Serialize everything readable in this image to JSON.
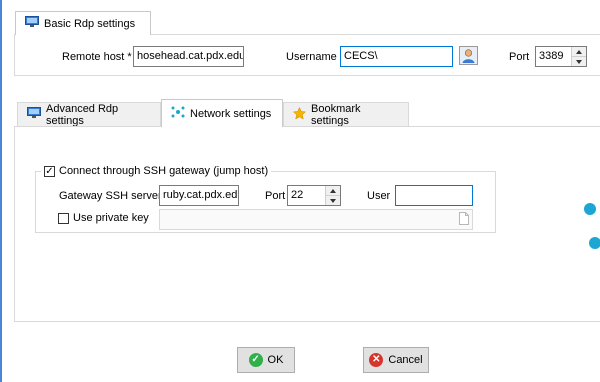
{
  "basic": {
    "tab_label": "Basic Rdp settings",
    "remote_host_label": "Remote host *",
    "remote_host_value": "hosehead.cat.pdx.edu",
    "username_label": "Username",
    "username_value": "CECS\\",
    "port_label": "Port",
    "port_value": "3389"
  },
  "tabs": [
    {
      "label": "Advanced Rdp settings",
      "icon": "monitor-icon"
    },
    {
      "label": "Network settings",
      "icon": "network-icon"
    },
    {
      "label": "Bookmark settings",
      "icon": "star-icon"
    }
  ],
  "ssh": {
    "connect_label": "Connect through SSH gateway (jump host)",
    "connect_checked": true,
    "gateway_label": "Gateway SSH server",
    "gateway_value": "ruby.cat.pdx.edu",
    "port_label": "Port",
    "port_value": "22",
    "user_label": "User",
    "user_value": "",
    "private_key_label": "Use private key",
    "private_key_checked": false,
    "private_key_value": ""
  },
  "buttons": {
    "ok": "OK",
    "cancel": "Cancel"
  },
  "colors": {
    "accent": "#0078d7",
    "ok_green": "#2fb04a",
    "cancel_red": "#d9342b",
    "dots": "#1ba6d4"
  }
}
